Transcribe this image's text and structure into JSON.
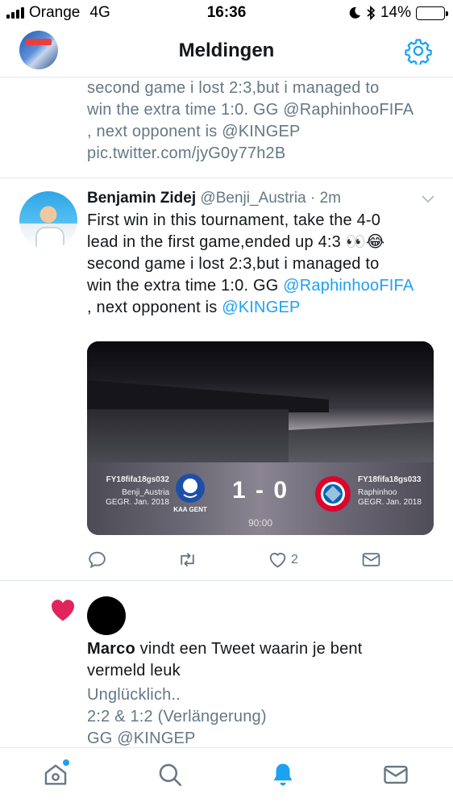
{
  "status_bar": {
    "carrier": "Orange",
    "network": "4G",
    "time": "16:36",
    "battery": "14%",
    "battery_level": 0.14,
    "icons": [
      "signal-icon",
      "moon-icon",
      "bluetooth-icon",
      "battery-icon"
    ]
  },
  "header": {
    "title": "Meldingen",
    "settings_icon": "gear-icon"
  },
  "partial_tweet": {
    "lines": [
      "second game i lost 2:3,but i managed to",
      "win the extra time 1:0. GG @RaphinhooFIFA",
      ", next opponent is @KINGEP",
      "pic.twitter.com/jyG0y77h2B"
    ]
  },
  "tweet": {
    "name": "Benjamin Zidej",
    "handle": "@Benji_Austria",
    "separator": "·",
    "time": "2m",
    "text_line1": "First win in this tournament, take the 4-0",
    "text_line2": "lead in the first game,ended up 4:3 👀😂",
    "text_line3": "second game i lost 2:3,but i managed to",
    "text_line4_prefix": "win the extra time 1:0. GG ",
    "mention1": "@RaphinhooFIFA",
    "text_line5_prefix": ", next opponent is ",
    "mention2": "@KINGEP",
    "media": {
      "home_id": "FY18fifa18gs032",
      "home_user": "Benji_Austria",
      "home_since": "GEGR. Jan. 2018",
      "home_club": "KAA GENT",
      "score": "1 - 0",
      "clock": "90:00",
      "away_id": "FY18fifa18gs033",
      "away_user": "Raphinhoo",
      "away_since": "GEGR. Jan. 2018"
    },
    "actions": {
      "reply_icon": "reply-icon",
      "retweet_icon": "retweet-icon",
      "like_icon": "heart-icon",
      "like_count": "2",
      "dm_icon": "envelope-icon"
    }
  },
  "notification": {
    "icon": "heart-icon",
    "user": "Marco",
    "action_text": " vindt een Tweet waarin je bent",
    "action_text2": "vermeld leuk",
    "quote_lines": [
      "Unglücklich..",
      "2:2 & 1:2 (Verlängerung)",
      "GG @KINGEP"
    ]
  },
  "tab_bar": {
    "items": [
      "home-icon",
      "search-icon",
      "notifications-bell-icon",
      "messages-envelope-icon"
    ],
    "active": "notifications-bell-icon",
    "accent": "#1da1f2"
  },
  "colors": {
    "accent": "#1da1f2",
    "like_red": "#e0245e",
    "secondary_text": "#657786"
  }
}
